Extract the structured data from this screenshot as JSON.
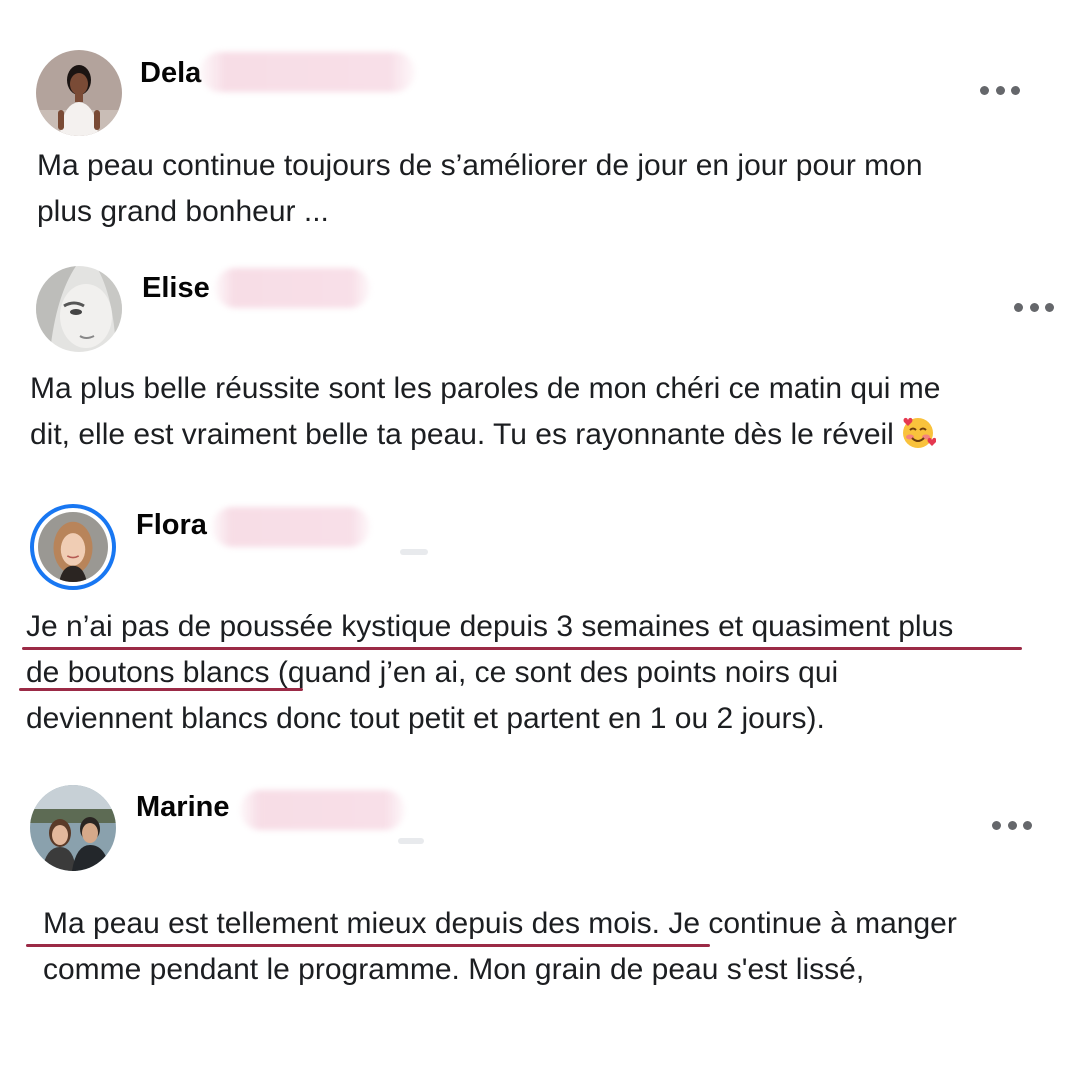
{
  "comments": [
    {
      "author": "Dela",
      "text_lines": [
        "Ma peau continue toujours de s’améliorer de jour en jour pour mon",
        "plus grand bonheur ..."
      ],
      "more_icon": "ellipsis-horizontal-icon"
    },
    {
      "author": "Elise",
      "text_lines": [
        "Ma plus belle réussite sont les paroles de mon chéri ce matin qui me",
        "dit, elle est vraiment belle ta peau. Tu es rayonnante dès le réveil"
      ],
      "emoji": "smiling-face-with-hearts",
      "more_icon": "ellipsis-horizontal-icon"
    },
    {
      "author": "Flora",
      "text_lines": [
        "Je n’ai pas de poussée kystique depuis 3 semaines et quasiment plus",
        "de boutons blancs (quand j’en ai, ce sont des points noirs qui",
        "deviennent blancs donc tout petit et partent en 1 ou 2 jours)."
      ],
      "highlight_color": "#9b2a46"
    },
    {
      "author": "Marine",
      "text_lines": [
        "Ma peau est tellement mieux depuis des mois. Je continue à manger",
        "comme pendant le programme. Mon grain de peau s'est lissé,"
      ],
      "highlight_color": "#9b2a46",
      "more_icon": "ellipsis-horizontal-icon"
    }
  ],
  "colors": {
    "story_ring": "#1877f2",
    "redaction": "#f7dde6",
    "icon_gray": "#65676b"
  }
}
